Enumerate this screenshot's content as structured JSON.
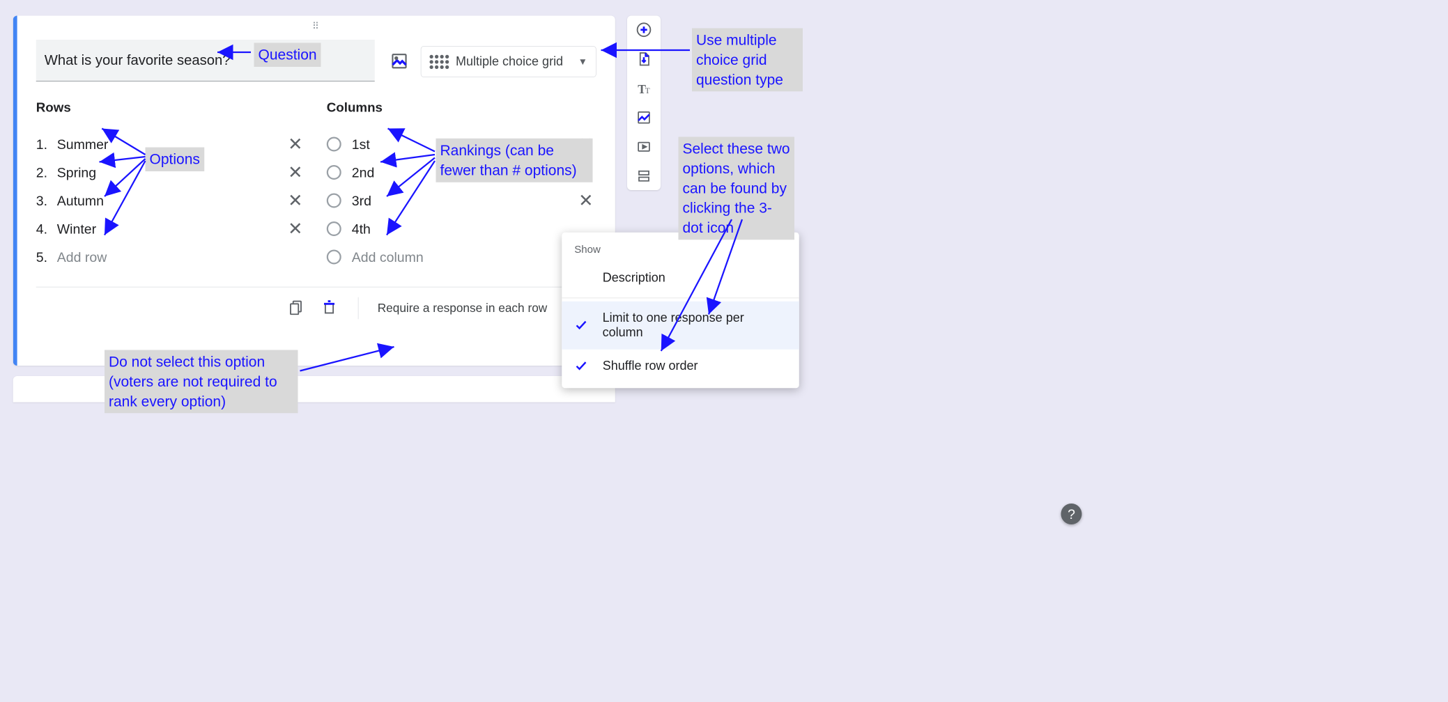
{
  "question": "What is your favorite season?",
  "questionType": "Multiple choice grid",
  "rowsHeader": "Rows",
  "columnsHeader": "Columns",
  "rows": [
    "Summer",
    "Spring",
    "Autumn",
    "Winter"
  ],
  "addRow": "Add row",
  "columns": [
    "1st",
    "2nd",
    "3rd",
    "4th"
  ],
  "addColumn": "Add column",
  "footer": {
    "requireLabel": "Require a response in each row"
  },
  "popover": {
    "showLabel": "Show",
    "description": "Description",
    "limit": "Limit to one response per column",
    "shuffle": "Shuffle row order"
  },
  "annotations": {
    "question": "Question",
    "options": "Options",
    "rankings": "Rankings (can be fewer than # options)",
    "useType": "Use multiple choice grid question type",
    "selectTwo": "Select these two options, which can be found by clicking the 3-dot icon",
    "dontSelect": "Do not select this option (voters are not required to rank every option)"
  }
}
